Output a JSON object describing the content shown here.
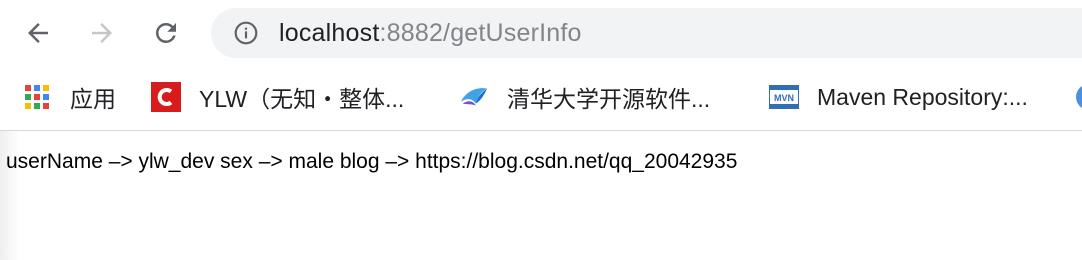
{
  "browser": {
    "back_icon": "arrow-left-icon",
    "forward_icon": "arrow-right-icon",
    "reload_icon": "reload-icon",
    "info_icon": "info-circle-icon",
    "url_host": "localhost",
    "url_path": ":8882/getUserInfo"
  },
  "bookmarks": [
    {
      "label": "应用",
      "icon": "apps-grid-icon"
    },
    {
      "label": "YLW（无知・整体...",
      "icon": "csdn-logo-icon"
    },
    {
      "label": "清华大学开源软件...",
      "icon": "tuna-bird-icon"
    },
    {
      "label": "Maven Repository:...",
      "icon": "mvn-logo-icon"
    }
  ],
  "page": {
    "text": "userName –> ylw_dev sex –> male blog –> https://blog.csdn.net/qq_20042935"
  },
  "colors": {
    "omnibox_bg": "#f1f3f4",
    "icon_gray": "#5f6368",
    "csdn_red": "#d61c1c",
    "mvn_blue": "#2f6fb8"
  }
}
